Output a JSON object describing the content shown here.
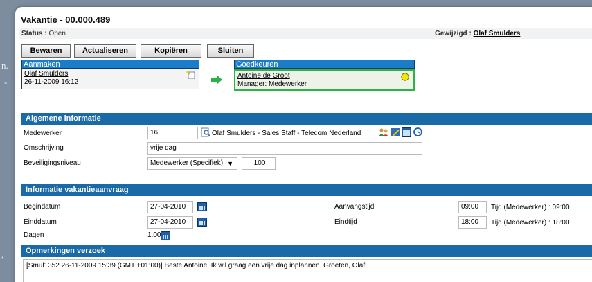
{
  "window": {
    "title": "Vakantie - 00.000.489"
  },
  "status": {
    "label": "Status :",
    "value": "Open",
    "modified_label": "Gewijzigd :",
    "modified_by": "Olaf Smulders"
  },
  "toolbar": {
    "save": "Bewaren",
    "refresh": "Actualiseren",
    "copy": "Kopiëren",
    "close": "Sluiten"
  },
  "workflow": {
    "create_header": "Aanmaken",
    "create_user": "Olaf Smulders",
    "create_date": "26-11-2009 16:12",
    "approve_header": "Goedkeuren",
    "approve_user": "Antoine de Groot",
    "approve_role": "Manager: Medewerker"
  },
  "general": {
    "header": "Algemene informatie",
    "employee_label": "Medewerker",
    "employee_value": "16",
    "employee_link": "Olaf Smulders - Sales Staff - Telecom Nederland",
    "description_label": "Omschrijving",
    "description_value": "vrije dag",
    "security_label": "Beveiligingsniveau",
    "security_value": "Medewerker (Specifiek)",
    "security_number": "100"
  },
  "vacation": {
    "header": "Informatie vakantieaanvraag",
    "start_label": "Begindatum",
    "start_value": "27-04-2010",
    "end_label": "Einddatum",
    "end_value": "27-04-2010",
    "days_label": "Dagen",
    "days_value": "1.00",
    "start_time_label": "Aanvangstijd",
    "start_time_value": "09:00",
    "start_time_note": "Tijd (Medewerker) : 09:00",
    "end_time_label": "Eindtijd",
    "end_time_value": "18:00",
    "end_time_note": "Tijd (Medewerker) : 18:00"
  },
  "remarks": {
    "header": "Opmerkingen verzoek",
    "text": "[Smul1352 26-11-2009 15:39 (GMT +01:00)] Beste Antoine, Ik wil graag een vrije dag inplannen. Groeten, Olaf"
  },
  "colors": {
    "section_header": "#1b6aa8",
    "workflow_header": "#1b7cc9",
    "approve_border": "#2db24a",
    "arrow": "#2db24a",
    "status_pending": "#f2e600"
  }
}
